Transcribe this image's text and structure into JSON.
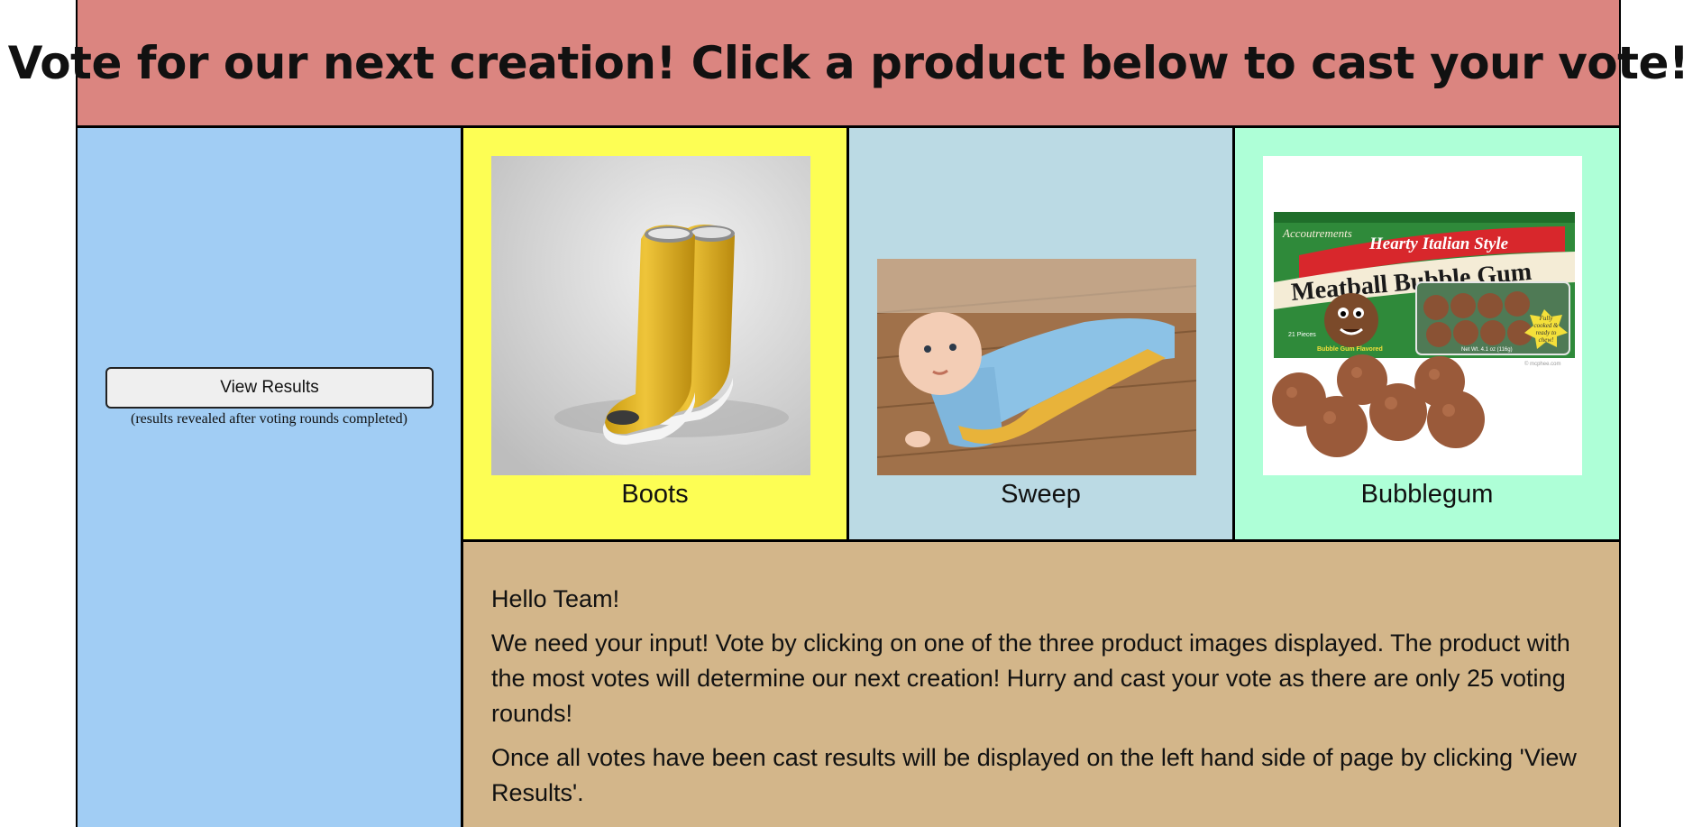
{
  "header": {
    "title": "Vote for our next creation! Click a product below to cast your vote!"
  },
  "sidebar": {
    "results_button": "View Results",
    "results_note": "(results revealed after voting rounds completed)"
  },
  "products": [
    {
      "name": "Boots",
      "image_icon": "yellow-rain-boots-image"
    },
    {
      "name": "Sweep",
      "image_icon": "baby-mop-onesie-image"
    },
    {
      "name": "Bubblegum",
      "image_icon": "meatball-bubble-gum-box-image"
    }
  ],
  "gum_box": {
    "brand": "Accoutrements",
    "tagline": "Hearty Italian Style",
    "product_name": "Meatball Bubble Gum",
    "pieces": "21 Pieces",
    "flavor": "Bubble Gum Flavored",
    "net_wt": "Net Wt. 4.1 oz (116g)",
    "burst_lines": [
      "Fully",
      "cooked &",
      "ready to",
      "chew!"
    ],
    "copyright": "© mcphee.com"
  },
  "info": {
    "greeting": "Hello Team!",
    "paragraph1": "We need your input! Vote by clicking on one of the three product images displayed. The product with the most votes will determine our next creation! Hurry and cast your vote as there are only 25 voting rounds!",
    "paragraph2": "Once all votes have been cast results will be displayed on the left hand side of page by clicking 'View Results'."
  },
  "colors": {
    "header": "#db8580",
    "sidebar": "#a1cdf4",
    "boots_panel": "#fdfe54",
    "sweep_panel": "#bbdae4",
    "gum_panel": "#aeffd7",
    "info_panel": "#d3b68a"
  }
}
